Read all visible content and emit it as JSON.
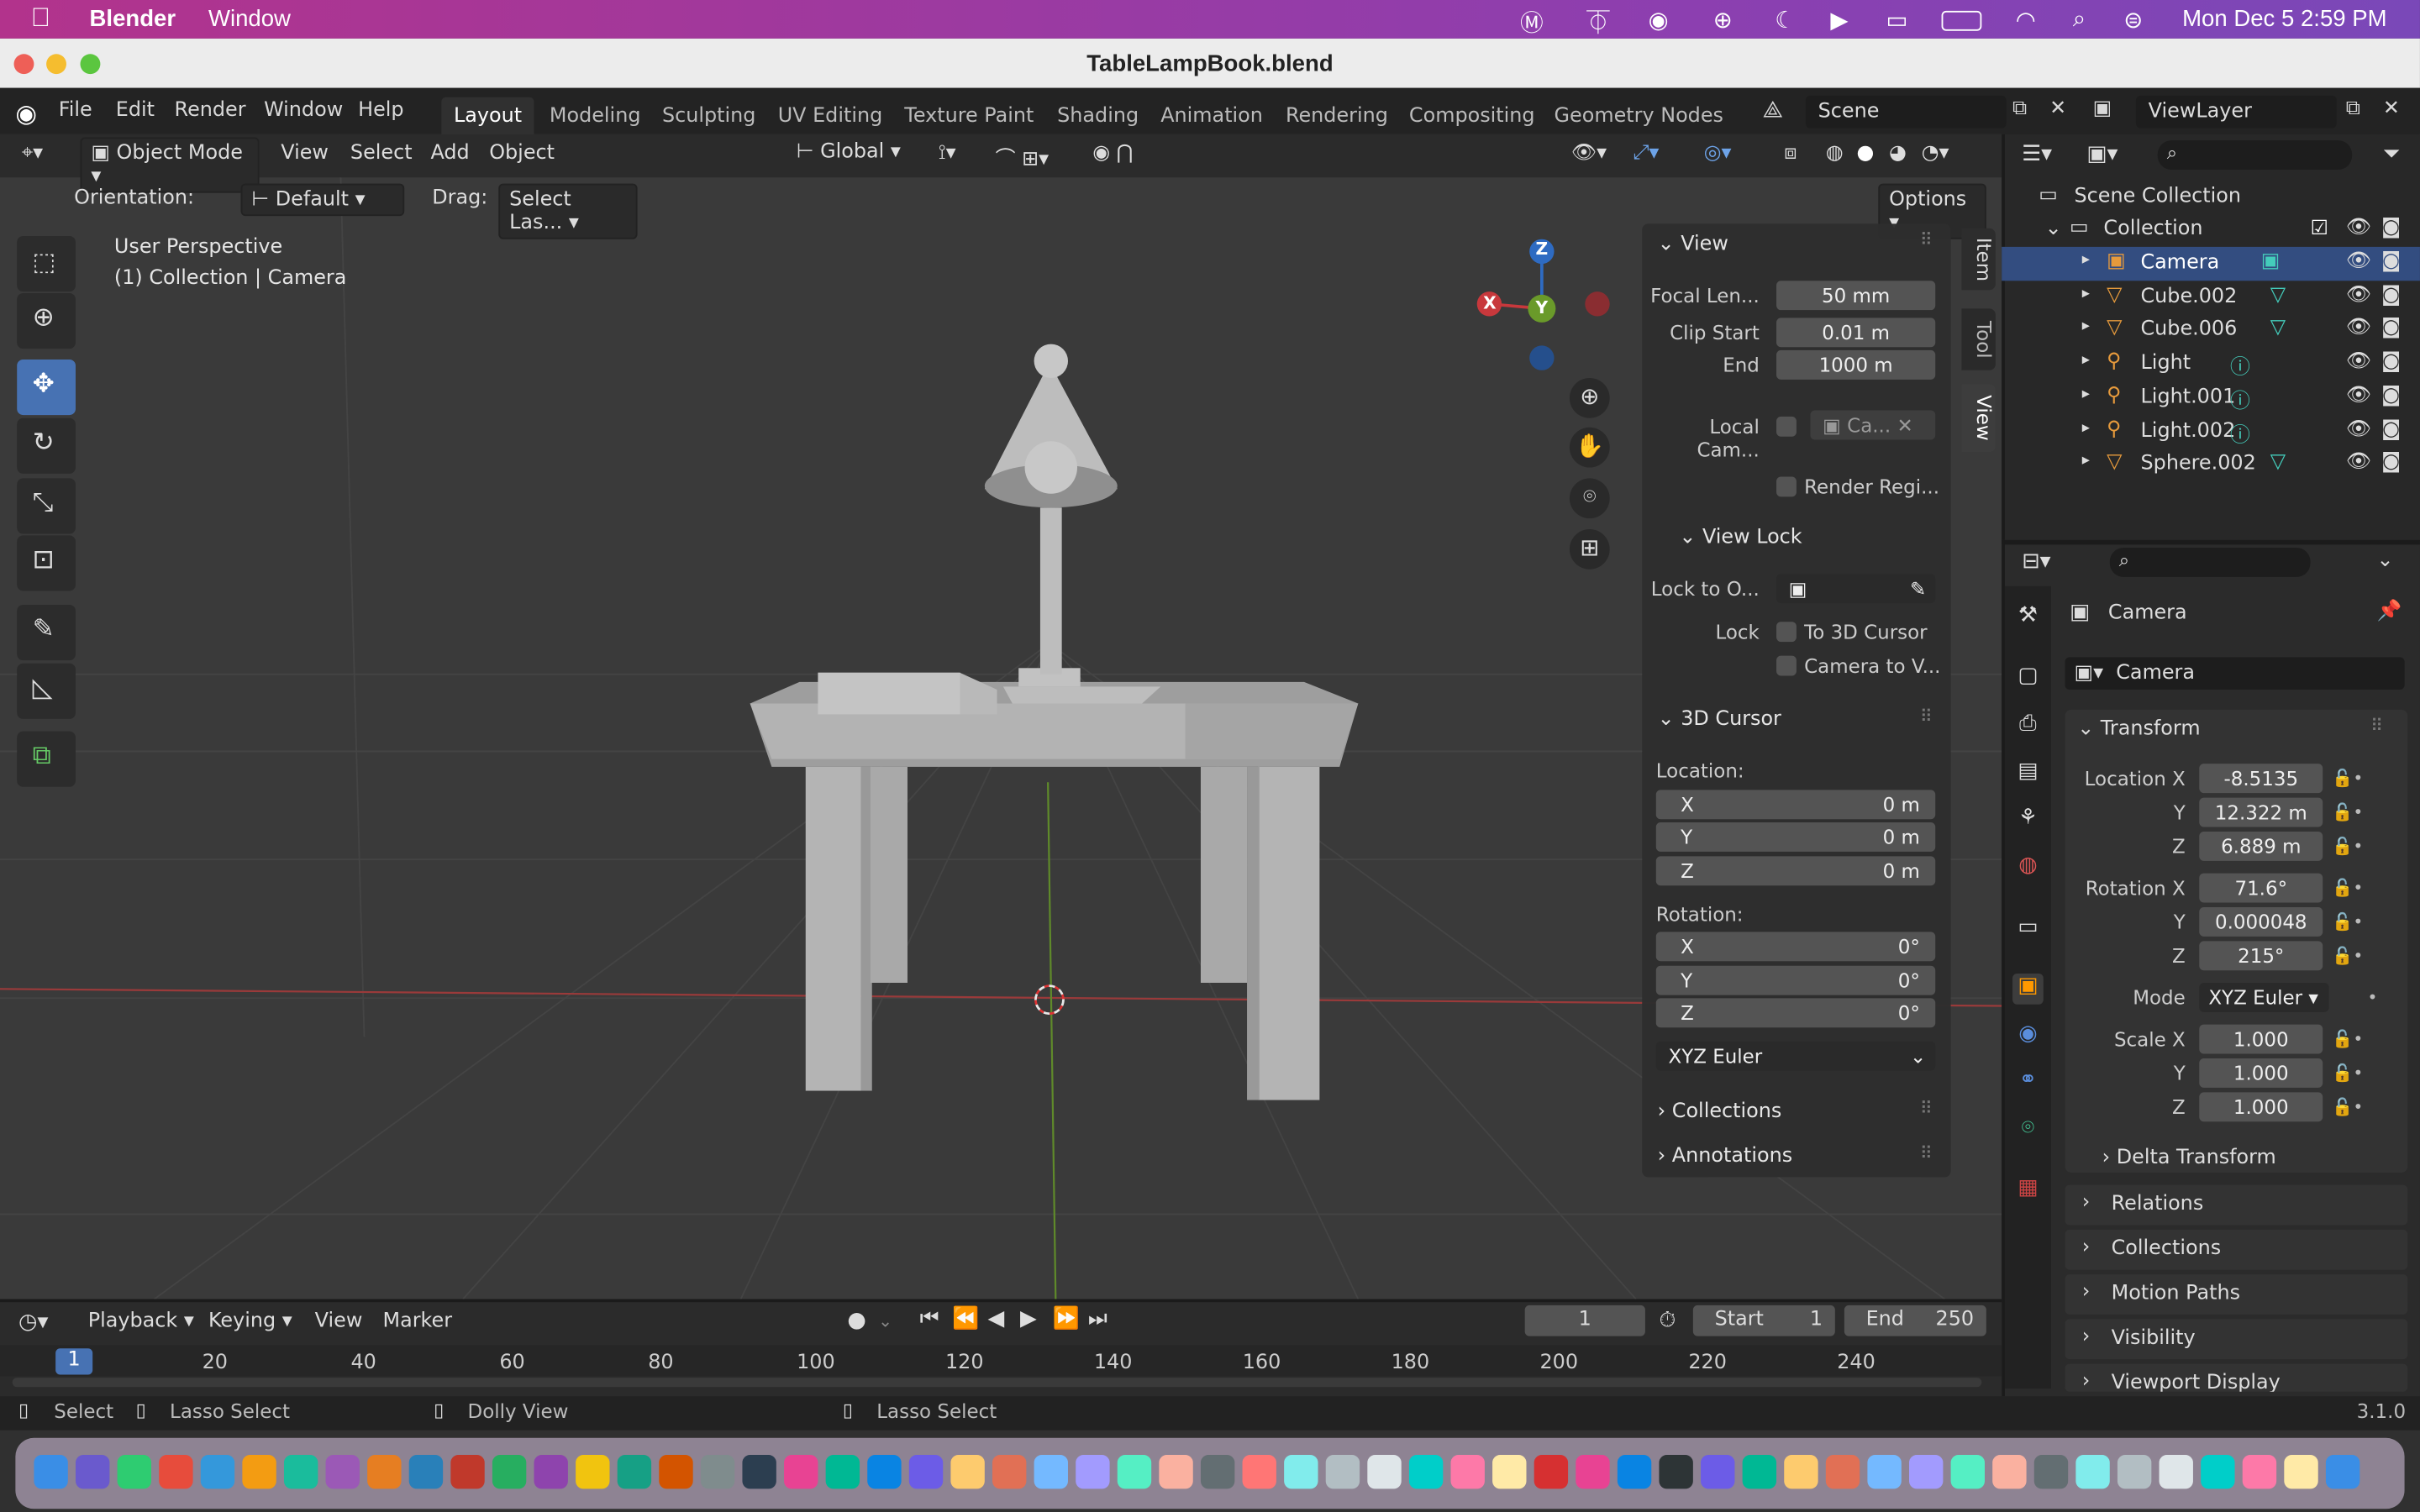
{
  "macbar": {
    "app": "Blender",
    "menu_window": "Window",
    "datetime": "Mon Dec 5  2:59 PM"
  },
  "window": {
    "title": "TableLampBook.blend"
  },
  "topmenu": {
    "file": "File",
    "edit": "Edit",
    "render": "Render",
    "window": "Window",
    "help": "Help"
  },
  "workspaces": [
    "Layout",
    "Modeling",
    "Sculpting",
    "UV Editing",
    "Texture Paint",
    "Shading",
    "Animation",
    "Rendering",
    "Compositing",
    "Geometry Nodes"
  ],
  "scene": {
    "scene_name": "Scene",
    "view_layer": "ViewLayer"
  },
  "viewport_header": {
    "mode": "Object Mode",
    "view": "View",
    "select": "Select",
    "add": "Add",
    "object": "Object",
    "transform": "Global"
  },
  "tool_settings": {
    "orientation_label": "Orientation:",
    "orientation_value": "Default",
    "drag_label": "Drag:",
    "drag_value": "Select Las...",
    "options": "Options"
  },
  "viewport": {
    "perspective": "User Perspective",
    "context": "(1) Collection | Camera",
    "gizmo_x": "X",
    "gizmo_y": "Y",
    "gizmo_z": "Z"
  },
  "npanel": {
    "tabs": [
      "Item",
      "Tool",
      "View"
    ],
    "view_title": "View",
    "focal_label": "Focal Len...",
    "focal_value": "50 mm",
    "clip_start_label": "Clip Start",
    "clip_start_value": "0.01 m",
    "clip_end_label": "End",
    "clip_end_value": "1000 m",
    "local_cam_label": "Local Cam...",
    "local_cam_value": "Ca...",
    "render_region": "Render Regi...",
    "view_lock_title": "View Lock",
    "lock_to_obj_label": "Lock to O...",
    "lock_label": "Lock",
    "to_cursor": "To 3D Cursor",
    "camera_to_view": "Camera to V...",
    "cursor_title": "3D Cursor",
    "location_label": "Location:",
    "loc_x": "0 m",
    "loc_y": "0 m",
    "loc_z": "0 m",
    "rotation_label": "Rotation:",
    "rot_x": "0°",
    "rot_y": "0°",
    "rot_z": "0°",
    "axis_x": "X",
    "axis_y": "Y",
    "axis_z": "Z",
    "rot_mode": "XYZ Euler",
    "collections": "Collections",
    "annotations": "Annotations"
  },
  "outliner": {
    "scene_collection": "Scene Collection",
    "collection": "Collection",
    "items": [
      {
        "name": "Camera",
        "type": "camera"
      },
      {
        "name": "Cube.002",
        "type": "mesh"
      },
      {
        "name": "Cube.006",
        "type": "mesh"
      },
      {
        "name": "Light",
        "type": "light"
      },
      {
        "name": "Light.001",
        "type": "light"
      },
      {
        "name": "Light.002",
        "type": "light"
      },
      {
        "name": "Sphere.002",
        "type": "mesh"
      }
    ]
  },
  "properties": {
    "object_name": "Camera",
    "data_name": "Camera",
    "transform_title": "Transform",
    "location_x_label": "Location X",
    "loc_x": "-8.5135",
    "loc_y": "12.322 m",
    "loc_z": "6.889 m",
    "rotation_x_label": "Rotation X",
    "rot_x": "71.6°",
    "rot_y": "0.000048",
    "rot_z": "215°",
    "mode_label": "Mode",
    "mode_value": "XYZ Euler",
    "scale_x_label": "Scale X",
    "scale_x": "1.000",
    "scale_y": "1.000",
    "scale_z": "1.000",
    "y": "Y",
    "z": "Z",
    "delta": "Delta Transform",
    "sections": [
      "Relations",
      "Collections",
      "Motion Paths",
      "Visibility",
      "Viewport Display"
    ]
  },
  "timeline": {
    "playback": "Playback",
    "keying": "Keying",
    "view": "View",
    "marker": "Marker",
    "current_frame": "1",
    "start_label": "Start",
    "start": "1",
    "end_label": "End",
    "end": "250",
    "ticks": [
      "20",
      "40",
      "60",
      "80",
      "100",
      "120",
      "140",
      "160",
      "180",
      "200",
      "220",
      "240"
    ],
    "cursor": "1"
  },
  "status": {
    "select": "Select",
    "lasso1": "Lasso Select",
    "dolly": "Dolly View",
    "lasso2": "Lasso Select",
    "version": "3.1.0"
  },
  "colors": {
    "accent": "#4772b3",
    "selected_row": "#334d80",
    "x_axis": "#c8383c",
    "y_axis": "#6a9a2a",
    "z_axis": "#2e6bc2"
  }
}
